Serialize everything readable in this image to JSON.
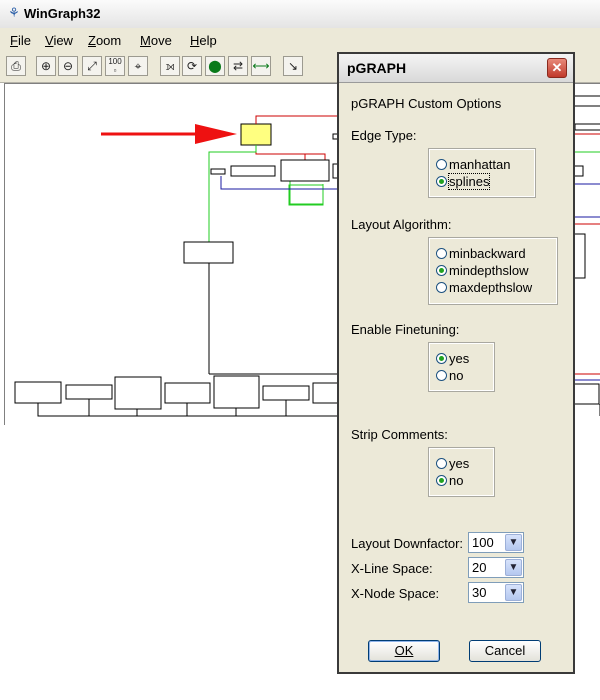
{
  "window": {
    "title": "WinGraph32",
    "icon": "graph-app-icon"
  },
  "menu": [
    {
      "label": "File",
      "accel": "F",
      "rest": "ile"
    },
    {
      "label": "View",
      "accel": "V",
      "rest": "iew"
    },
    {
      "label": "Zoom",
      "accel": "Z",
      "rest": "oom"
    },
    {
      "label": "Move",
      "accel": "M",
      "rest": "ove"
    },
    {
      "label": "Help",
      "accel": "H",
      "rest": "elp"
    }
  ],
  "toolbar": {
    "zoom_100_label": "100"
  },
  "dialog": {
    "title": "pGRAPH",
    "heading": "pGRAPH Custom Options",
    "edge_type": {
      "label": "Edge Type:",
      "options": [
        "manhattan",
        "splines"
      ],
      "selected": "splines"
    },
    "layout_algorithm": {
      "label": "Layout Algorithm:",
      "options": [
        "minbackward",
        "mindepthslow",
        "maxdepthslow"
      ],
      "selected": "mindepthslow"
    },
    "finetuning": {
      "label": "Enable Finetuning:",
      "options": [
        "yes",
        "no"
      ],
      "selected": "yes"
    },
    "strip_comments": {
      "label": "Strip Comments:",
      "options": [
        "yes",
        "no"
      ],
      "selected": "no"
    },
    "layout_downfactor": {
      "label": "Layout Downfactor:",
      "value": "100"
    },
    "x_line_space": {
      "label": "X-Line Space:",
      "value": "20"
    },
    "x_node_space": {
      "label": "X-Node Space:",
      "value": "30"
    },
    "ok_label": "OK",
    "cancel_label": "Cancel"
  },
  "colors": {
    "highlight_node": "#ffff80",
    "arrow": "#ee1111",
    "edge_red": "#cc0000",
    "edge_green": "#22cc22",
    "edge_blue": "#1a1aa0"
  }
}
